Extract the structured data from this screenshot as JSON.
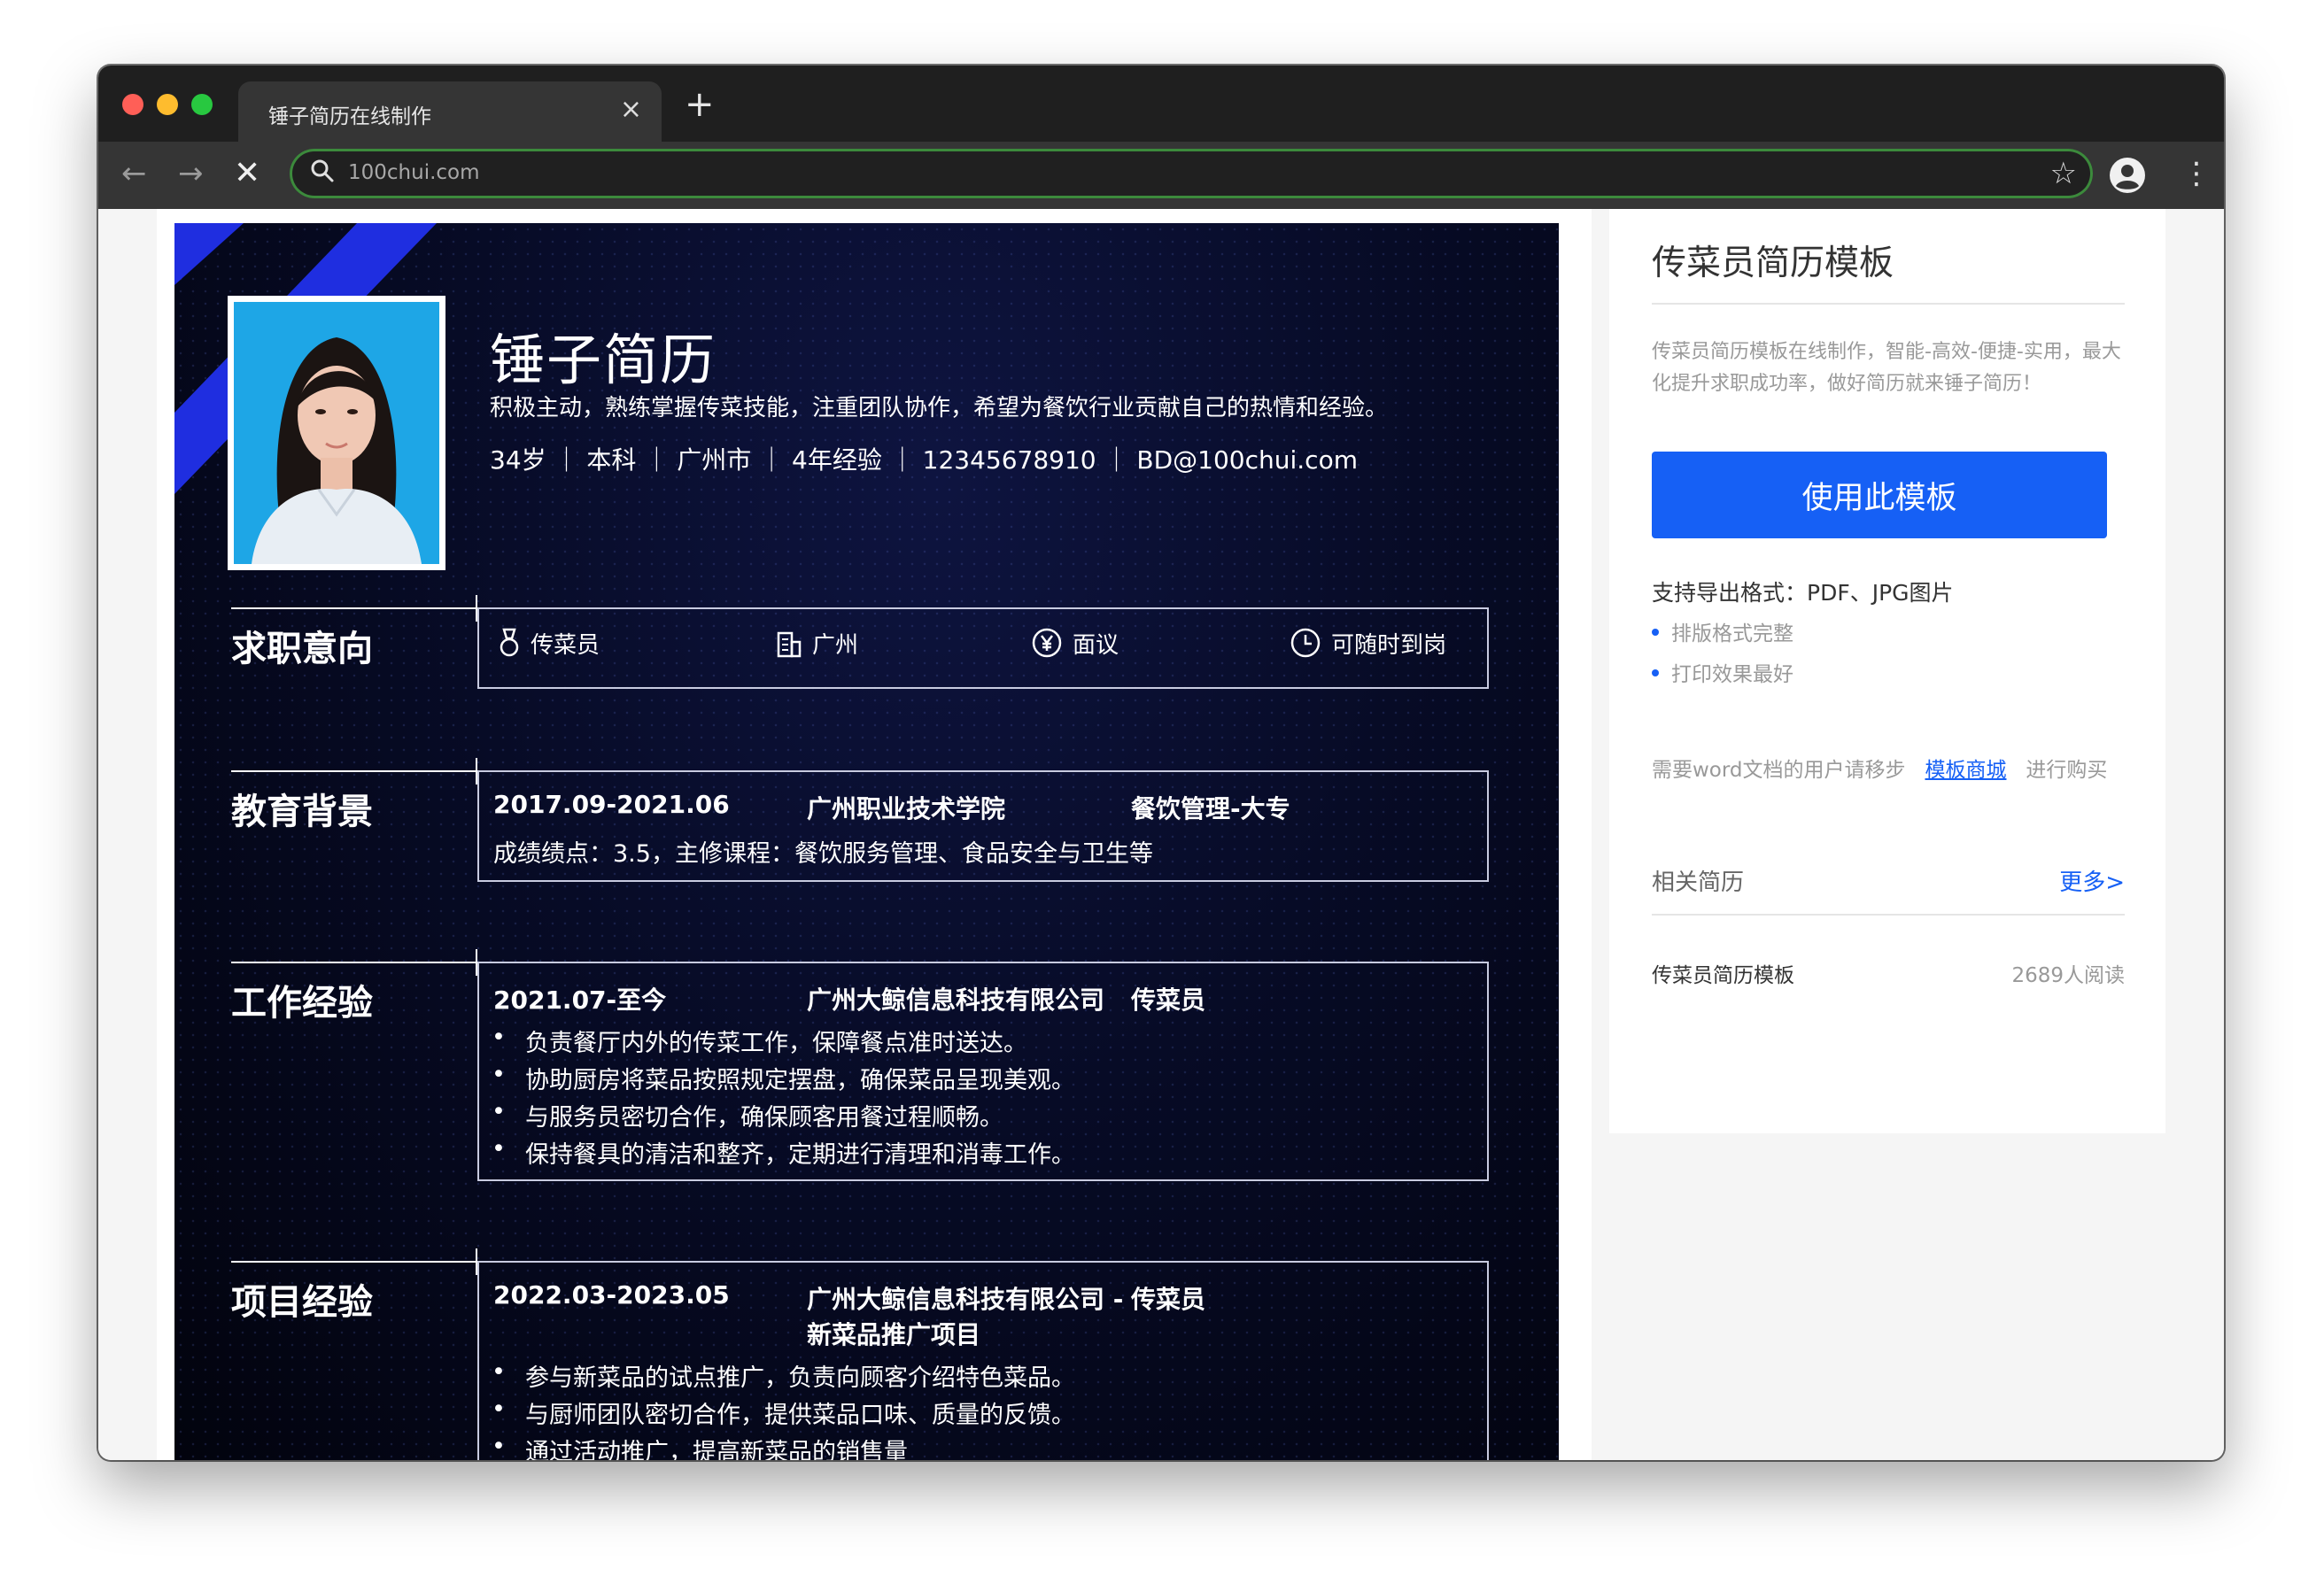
{
  "browser": {
    "tab_title": "锤子简历在线制作",
    "tab_close": "×",
    "new_tab": "+",
    "url": "100chui.com",
    "back": "←",
    "forward": "→",
    "stop": "✕",
    "star": "☆",
    "menu": "⋮"
  },
  "resume": {
    "name": "锤子简历",
    "intro": "积极主动，熟练掌握传菜技能，注重团队协作，希望为餐饮行业贡献自己的热情和经验。",
    "info": "34岁 ｜ 本科 ｜ 广州市 ｜ 4年经验 ｜ 12345678910 ｜ BD@100chui.com",
    "intent": {
      "title": "求职意向",
      "position": "传菜员",
      "city": "广州",
      "salary": "面议",
      "availability": "可随时到岗"
    },
    "education": {
      "title": "教育背景",
      "period": "2017.09-2021.06",
      "school": "广州职业技术学院",
      "major": "餐饮管理-大专",
      "detail": "成绩绩点：3.5，主修课程：餐饮服务管理、食品安全与卫生等"
    },
    "work": {
      "title": "工作经验",
      "period": "2021.07-至今",
      "company": "广州大鲸信息科技有限公司",
      "role": "传菜员",
      "bullets": [
        "负责餐厅内外的传菜工作，保障餐点准时送达。",
        "协助厨房将菜品按照规定摆盘，确保菜品呈现美观。",
        "与服务员密切合作，确保顾客用餐过程顺畅。",
        "保持餐具的清洁和整齐，定期进行清理和消毒工作。"
      ]
    },
    "project": {
      "title": "项目经验",
      "period": "2022.03-2023.05",
      "name_line1": "广州大鲸信息科技有限公司 -",
      "name_line2": "新菜品推广项目",
      "role": "传菜员",
      "bullets": [
        "参与新菜品的试点推广，负责向顾客介绍特色菜品。",
        "与厨师团队密切合作，提供菜品口味、质量的反馈。",
        "通过活动推广，提高新菜品的销售量"
      ]
    }
  },
  "sidebar": {
    "title": "传菜员简历模板",
    "description": "传菜员简历模板在线制作，智能-高效-便捷-实用，最大化提升求职成功率，做好简历就来锤子简历！",
    "use_button": "使用此模板",
    "formats": "支持导出格式：PDF、JPG图片",
    "features": [
      "排版格式完整",
      "打印效果最好"
    ],
    "word_prefix": "需要word文档的用户请移步",
    "word_link": "模板商城",
    "word_suffix": "进行购买",
    "related_title": "相关简历",
    "more": "更多>",
    "related_item": "传菜员简历模板",
    "related_reads": "2689人阅读"
  },
  "colors": {
    "accent": "#1660f5",
    "resume_bg": "#070b26",
    "stripe": "#1f2ee0"
  },
  "icons": [
    "search-icon",
    "star-icon",
    "profile-icon",
    "menu-icon",
    "medal-icon",
    "building-icon",
    "yen-icon",
    "clock-icon"
  ]
}
